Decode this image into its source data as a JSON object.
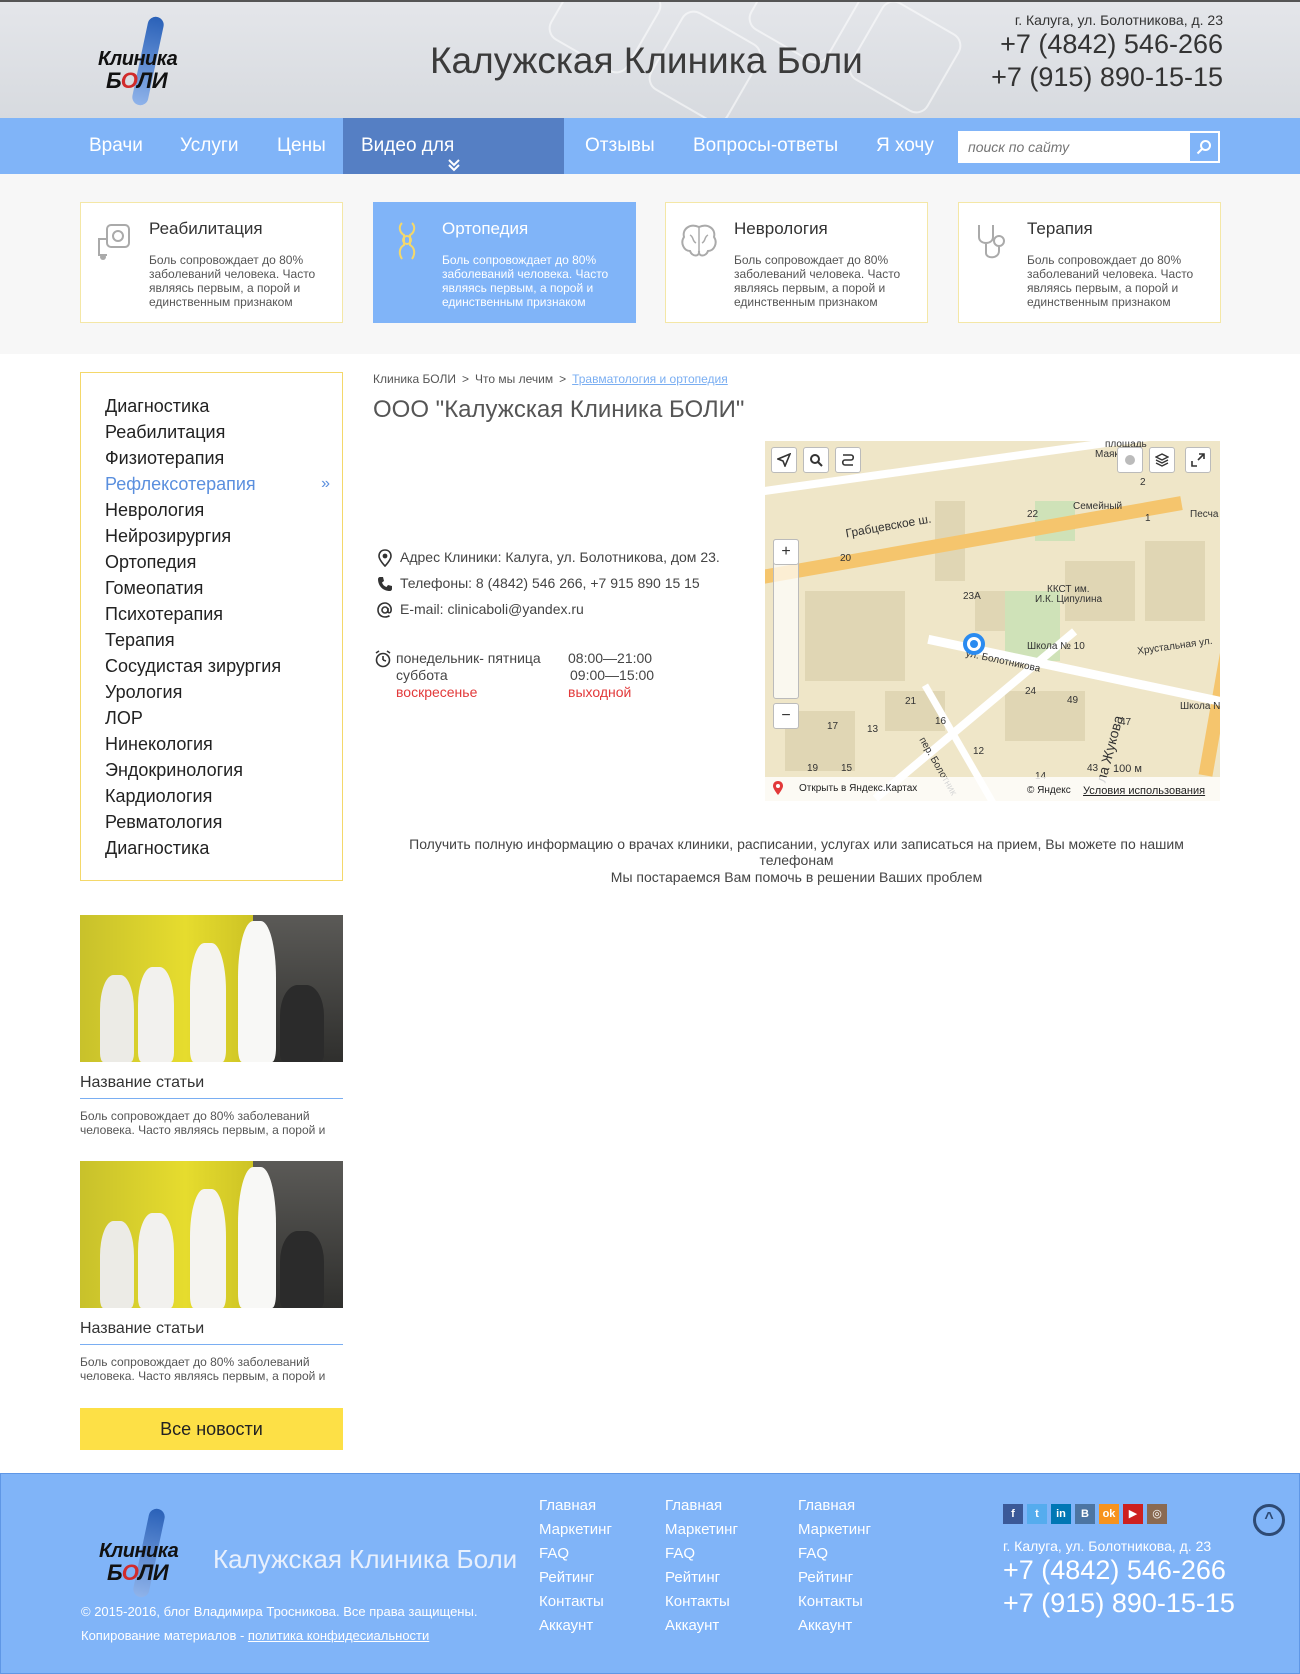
{
  "header": {
    "logo_line1": "Клиника",
    "logo_line2_a": "Б",
    "logo_line2_o": "О",
    "logo_line2_b": "ЛИ",
    "site_title": "Калужская Клиника Боли",
    "address": "г. Калуга, ул. Болотникова, д. 23",
    "phone1": "+7 (4842) 546-266",
    "phone2": "+7 (915) 890-15-15"
  },
  "nav": {
    "items": [
      "Врачи",
      "Услуги",
      "Цены",
      "Видео для пауиентов",
      "Отзывы",
      "Вопросы-ответы",
      "Я хочу"
    ],
    "active_chevron": "»",
    "search_placeholder": "поиск по сайту"
  },
  "cards": [
    {
      "title": "Реабилитация",
      "desc": "Боль сопровождает до 80% заболеваний человека. Часто являясь первым, а порой и единственным признаком",
      "icon": "rehab-icon"
    },
    {
      "title": "Ортопедия",
      "desc": "Боль сопровождает до 80% заболеваний человека. Часто являясь первым, а порой и единственным признаком",
      "icon": "joint-icon"
    },
    {
      "title": "Неврология",
      "desc": "Боль сопровождает до 80% заболеваний человека. Часто являясь первым, а порой и единственным признаком",
      "icon": "brain-icon"
    },
    {
      "title": "Терапия",
      "desc": "Боль сопровождает до 80% заболеваний человека. Часто являясь первым, а порой и единственным признаком",
      "icon": "stethoscope-icon"
    }
  ],
  "side_menu": {
    "items": [
      "Диагностика",
      "Реабилитация",
      "Физиотерапия",
      "Рефлексотерапия",
      "Неврология",
      "Нейрозирургия",
      "Ортопедия",
      "Гомеопатия",
      "Психотерапия",
      "Терапия",
      "Сосудистая зирургия",
      "Урология",
      "ЛОР",
      "Нинекология",
      "Эндокринология",
      "Кардиология",
      "Ревматология",
      "Диагностика"
    ],
    "active_arrow": "»"
  },
  "articles": [
    {
      "title": "Название статьи",
      "desc": "Боль сопровождает до 80% заболеваний человека. Часто являясь первым, а порой и"
    },
    {
      "title": "Название статьи",
      "desc": "Боль сопровождает до 80% заболеваний человека. Часто являясь первым, а порой и"
    }
  ],
  "all_news": "Все новости",
  "breadcrumb": {
    "items": [
      "Клиника БОЛИ",
      "Что мы лечим",
      "Травматология и ортопедия"
    ],
    "sep": ">"
  },
  "page_title": "ООО \"Калужская Клиника БОЛИ\"",
  "contacts": {
    "address": "Адрес Клиники: Калуга, ул. Болотникова, дом 23.",
    "phones": "Телефоны: 8 (4842) 546 266, +7 915 890 15 15",
    "email": "E-mail: clinicaboli@yandex.ru"
  },
  "hours": [
    {
      "day": "понедельник- пятница",
      "time": "08:00—21:00"
    },
    {
      "day": "суббота",
      "time": "09:00—15:00"
    },
    {
      "day": "воскресенье",
      "time": "выходной"
    }
  ],
  "map": {
    "labels": [
      "площадь",
      "Маяковск",
      "Грабцевское ш.",
      "Семейный",
      "ККСТ им.",
      "И.К. Ципулина",
      "Школа № 10",
      "ул. Болотникова",
      "Хрустальная ул.",
      "Школа N",
      "пер. Болотник",
      "ла Жукова",
      "Песча",
      "23А",
      "22",
      "20",
      "21",
      "17",
      "13",
      "16",
      "12",
      "24",
      "49",
      "47",
      "19",
      "15",
      "14",
      "43",
      "2",
      "1"
    ],
    "scale": "100 м",
    "open_link": "Открыть в Яндекс.Картах",
    "copyright": "© Яндекс",
    "terms": "Условия использования"
  },
  "info_note1": "Получить полную информацию о врачах клиники, расписании, услугах или записаться на прием, Вы можете по нашим телефонам",
  "info_note2": "Мы постараемся Вам помочь в решении Ваших проблем",
  "footer": {
    "title": "Калужская Клиника Боли",
    "copyright": "© 2015-2016, блог Владимира Тросникова. Все права защищены.",
    "copy_prefix": "Копирование материалов - ",
    "policy_link": "политика конфидесиальности",
    "columns": [
      [
        "Главная",
        "Маркетинг",
        "FAQ",
        "Рейтинг",
        "Контакты",
        "Аккаунт"
      ],
      [
        "Главная",
        "Маркетинг",
        "FAQ",
        "Рейтинг",
        "Контакты",
        "Аккаунт"
      ],
      [
        "Главная",
        "Маркетинг",
        "FAQ",
        "Рейтинг",
        "Контакты",
        "Аккаунт"
      ]
    ],
    "socials": [
      {
        "name": "facebook-icon",
        "glyph": "f",
        "color": "#3b5998"
      },
      {
        "name": "twitter-icon",
        "glyph": "t",
        "color": "#55acee"
      },
      {
        "name": "linkedin-icon",
        "glyph": "in",
        "color": "#0077b5"
      },
      {
        "name": "vk-icon",
        "glyph": "B",
        "color": "#4c75a3"
      },
      {
        "name": "odnoklassniki-icon",
        "glyph": "ok",
        "color": "#f7931e"
      },
      {
        "name": "youtube-icon",
        "glyph": "▶",
        "color": "#cd201f"
      },
      {
        "name": "instagram-icon",
        "glyph": "◎",
        "color": "#8a6a52"
      }
    ],
    "address": "г. Калуга, ул. Болотникова, д. 23",
    "phone1": "+7 (4842) 546-266",
    "phone2": "+7 (915) 890-15-15",
    "to_top": "^"
  },
  "colors": {
    "nav_bg": "#80b4f8",
    "nav_active": "#557fc4",
    "accent_yellow": "#fde046",
    "link_blue": "#5a8fde",
    "closed_red": "#e2393a"
  }
}
